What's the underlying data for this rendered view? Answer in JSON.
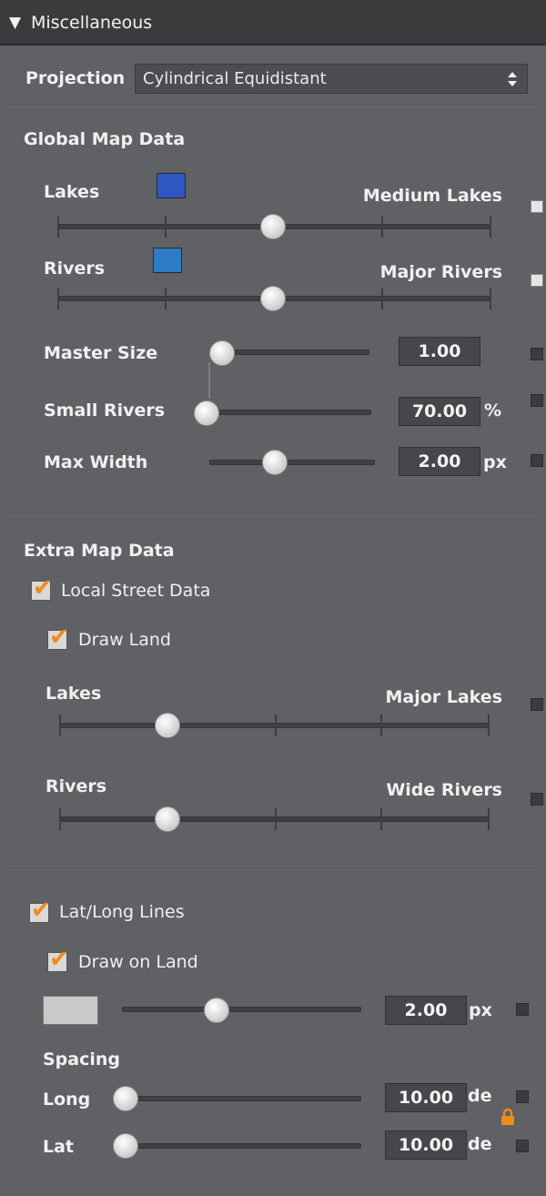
{
  "header": {
    "toggle_icon": "collapse-triangle-icon",
    "title": "Miscellaneous"
  },
  "projection": {
    "label": "Projection",
    "value": "Cylindrical Equidistant",
    "dropdown_icon": "updown-arrows-icon"
  },
  "global_map_data": {
    "title": "Global Map Data",
    "lakes": {
      "label": "Lakes",
      "color": "#2f57c4",
      "value_label": "Medium Lakes",
      "slider_fraction": 0.5
    },
    "rivers": {
      "label": "Rivers",
      "color": "#2f7bc4",
      "value_label": "Major Rivers",
      "slider_fraction": 0.5
    },
    "master_size": {
      "label": "Master Size",
      "value": "1.00",
      "unit": ""
    },
    "small_rivers": {
      "label": "Small Rivers",
      "value": "70.00",
      "unit": "%"
    },
    "max_width": {
      "label": "Max Width",
      "value": "2.00",
      "unit": "px"
    }
  },
  "extra_map_data": {
    "title": "Extra Map Data",
    "local_street_data": {
      "label": "Local Street Data",
      "checked": true
    },
    "draw_land": {
      "label": "Draw Land",
      "checked": true
    },
    "lakes": {
      "label": "Lakes",
      "value_label": "Major Lakes",
      "slider_fraction": 0.25
    },
    "rivers": {
      "label": "Rivers",
      "value_label": "Wide Rivers",
      "slider_fraction": 0.25
    }
  },
  "lat_long": {
    "label": "Lat/Long Lines",
    "checked": true,
    "draw_on_land": {
      "label": "Draw on Land",
      "checked": true
    },
    "line_color": "#c9c9c9",
    "width": {
      "value": "2.00",
      "unit": "px"
    },
    "spacing_title": "Spacing",
    "long": {
      "label": "Long",
      "value": "10.00",
      "unit": "de"
    },
    "lat": {
      "label": "Lat",
      "value": "10.00",
      "unit": "de"
    },
    "lock_icon": "lock-icon"
  },
  "checkmark": "✔"
}
